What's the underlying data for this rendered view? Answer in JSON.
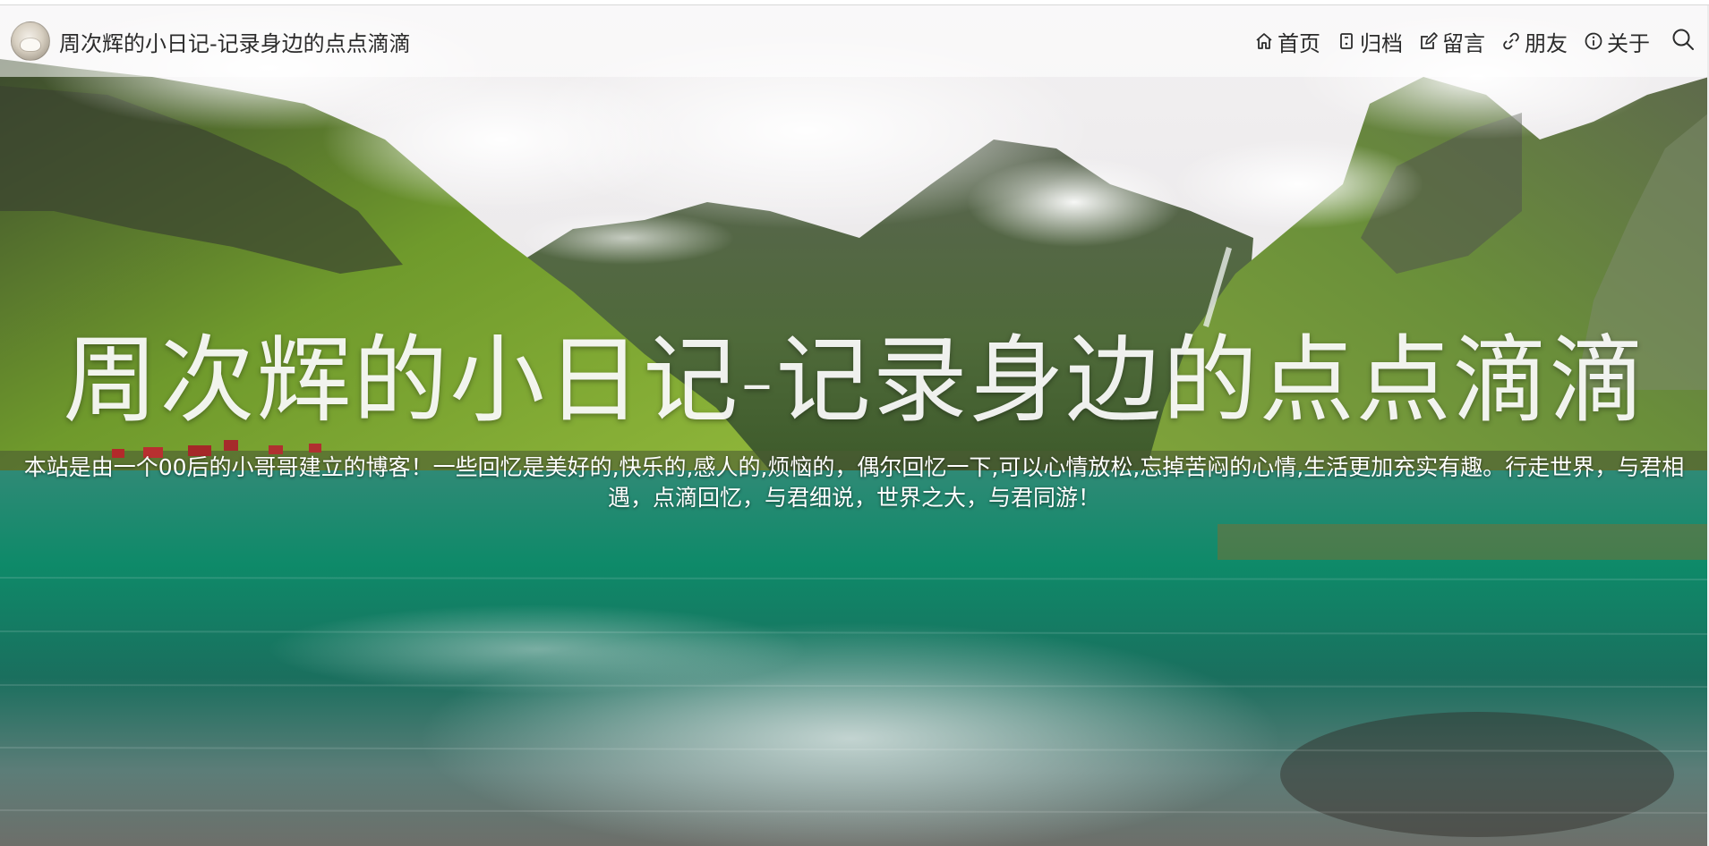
{
  "site": {
    "title": "周次辉的小日记-记录身边的点点滴滴"
  },
  "nav": {
    "items": [
      {
        "label": "首页",
        "icon": "home-icon"
      },
      {
        "label": "归档",
        "icon": "archive-icon"
      },
      {
        "label": "留言",
        "icon": "edit-icon"
      },
      {
        "label": "朋友",
        "icon": "link-icon"
      },
      {
        "label": "关于",
        "icon": "info-icon"
      }
    ],
    "search_icon": "search-icon"
  },
  "hero": {
    "title": "周次辉的小日记-记录身边的点点滴滴",
    "description": "本站是由一个00后的小哥哥建立的博客！一些回忆是美好的,快乐的,感人的,烦恼的，偶尔回忆一下,可以心情放松,忘掉苦闷的心情,生活更加充实有趣。行走世界，与君相遇，点滴回忆，与君细说，世界之大，与君同游！"
  },
  "colors": {
    "nav_text": "#2b2b2b",
    "nav_bg": "rgba(255,255,255,0.55)",
    "hero_text": "#ffffff",
    "water": "#0f8a6a",
    "mountain": "#4f7f2c"
  }
}
